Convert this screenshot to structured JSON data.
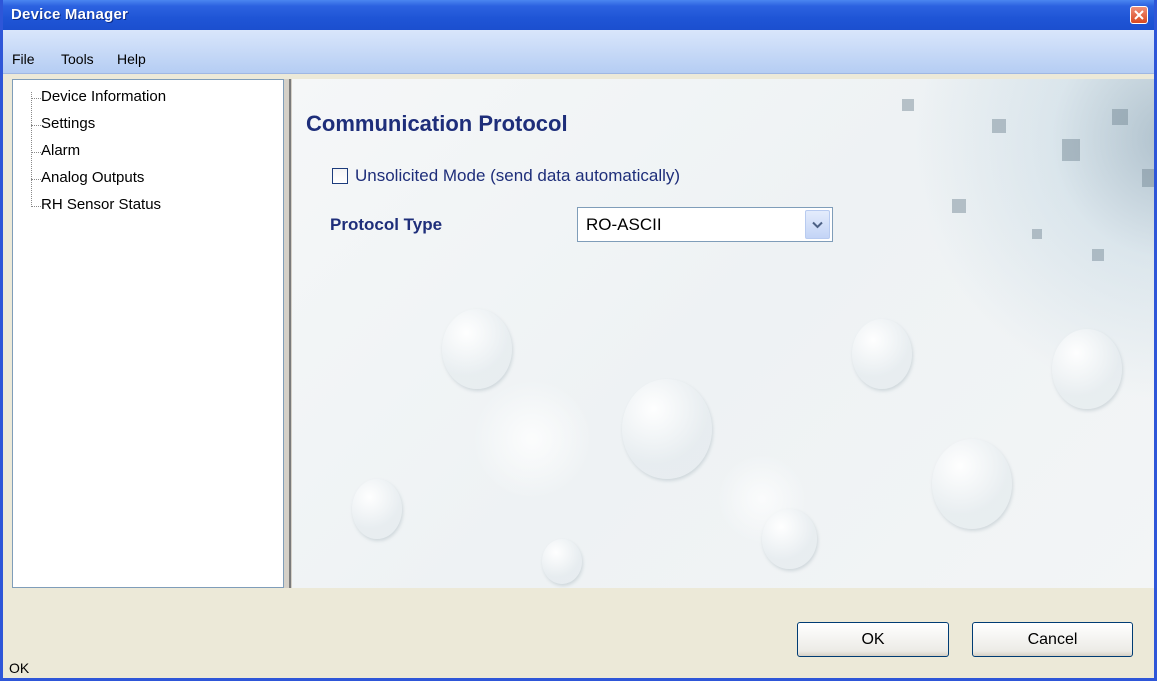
{
  "window": {
    "title": "Device Manager"
  },
  "menu": {
    "items": [
      "File",
      "Tools",
      "Help"
    ]
  },
  "tree": {
    "items": [
      {
        "label": "Device Information"
      },
      {
        "label": "Settings"
      },
      {
        "label": "Alarm"
      },
      {
        "label": "Analog Outputs"
      },
      {
        "label": "RH Sensor Status"
      }
    ]
  },
  "content": {
    "section_title": "Communication Protocol",
    "unsolicited_checkbox": {
      "label": "Unsolicited Mode (send data automatically)",
      "checked": false
    },
    "protocol_type": {
      "label": "Protocol Type",
      "value": "RO-ASCII"
    }
  },
  "buttons": {
    "ok": "OK",
    "cancel": "Cancel"
  },
  "status": {
    "text": "OK"
  },
  "colors": {
    "titlebar": "#1f55d6",
    "heading": "#1e2e7a",
    "close": "#d8481f"
  },
  "icons": {
    "close": "close-icon",
    "dropdown": "chevron-down-icon"
  }
}
